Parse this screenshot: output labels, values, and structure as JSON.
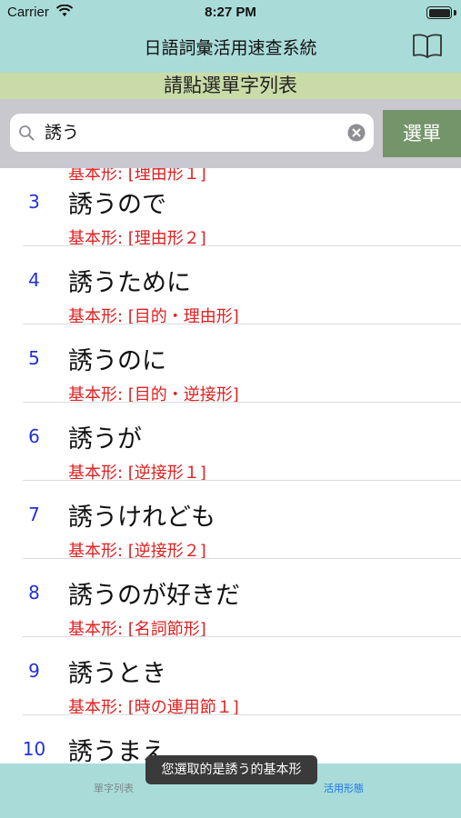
{
  "status_bar": {
    "carrier": "Carrier",
    "time": "8:27 PM"
  },
  "nav": {
    "title": "日語詞彙活用速查系統",
    "book_icon": "book-icon"
  },
  "subtitle": "請點選單字列表",
  "search": {
    "value": "誘う",
    "button_label": "選單"
  },
  "list": {
    "partial_text": "基本形: [理由形１]",
    "rows": [
      {
        "num": "3",
        "word": "誘うので",
        "base": "基本形: [理由形２]"
      },
      {
        "num": "4",
        "word": "誘うために",
        "base": "基本形: [目的・理由形]"
      },
      {
        "num": "5",
        "word": "誘うのに",
        "base": "基本形: [目的・逆接形]"
      },
      {
        "num": "6",
        "word": "誘うが",
        "base": "基本形: [逆接形１]"
      },
      {
        "num": "7",
        "word": "誘うけれども",
        "base": "基本形: [逆接形２]"
      },
      {
        "num": "8",
        "word": "誘うのが好きだ",
        "base": "基本形: [名詞節形]"
      },
      {
        "num": "9",
        "word": "誘うとき",
        "base": "基本形: [時の連用節１]"
      },
      {
        "num": "10",
        "word": "誘うまえ",
        "base": ""
      }
    ]
  },
  "tabs": {
    "list_label": "單字列表",
    "form_label": "活用形態"
  },
  "toast": "您選取的是誘う的基本形",
  "colors": {
    "nav_bg": "#a9dcd9",
    "subtitle_bg": "#c9dca7",
    "button_bg": "#74946a",
    "number": "#2232d8",
    "base_form": "#e02020"
  }
}
